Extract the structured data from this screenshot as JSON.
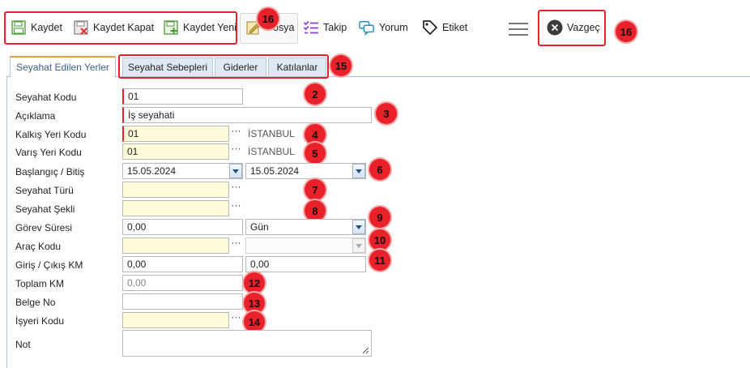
{
  "toolbar": {
    "save": "Kaydet",
    "save_close": "Kaydet Kapat",
    "save_new": "Kaydet Yeni",
    "file": "Dosya",
    "follow": "Takip",
    "comment": "Yorum",
    "tag": "Etiket",
    "cancel": "Vazgeç"
  },
  "tabs": {
    "main": "Seyahat Edilen Yerler",
    "reasons": "Seyahat Sebepleri",
    "expenses": "Giderler",
    "participants": "Katılanlar"
  },
  "badges": {
    "b2": "2",
    "b3": "3",
    "b4": "4",
    "b5": "5",
    "b6": "6",
    "b7": "7",
    "b8": "8",
    "b9": "9",
    "b10": "10",
    "b11": "11",
    "b12": "12",
    "b13": "13",
    "b14": "14",
    "b15": "15",
    "b16a": "16",
    "b16b": "16"
  },
  "form": {
    "travel_code": {
      "label": "Seyahat Kodu",
      "value": "01"
    },
    "description": {
      "label": "Açıklama",
      "value": "İş seyahati"
    },
    "departure": {
      "label": "Kalkış Yeri Kodu",
      "value": "01",
      "name": "İSTANBUL"
    },
    "arrival": {
      "label": "Varış Yeri Kodu",
      "value": "01",
      "name": "İSTANBUL"
    },
    "dates": {
      "label": "Başlangıç / Bitiş",
      "start": "15.05.2024",
      "end": "15.05.2024"
    },
    "travel_type": {
      "label": "Seyahat Türü",
      "value": ""
    },
    "travel_mode": {
      "label": "Seyahat Şekli",
      "value": ""
    },
    "duty_duration": {
      "label": "Görev Süresi",
      "value": "0,00",
      "unit": "Gün"
    },
    "vehicle_code": {
      "label": "Araç Kodu",
      "value": ""
    },
    "km": {
      "label": "Giriş / Çıkış KM",
      "in": "0,00",
      "out": "0,00"
    },
    "total_km": {
      "label": "Toplam KM",
      "value": "0,00"
    },
    "doc_no": {
      "label": "Belge No",
      "value": ""
    },
    "workplace_code": {
      "label": "İşyeri Kodu",
      "value": ""
    },
    "note": {
      "label": "Not",
      "value": ""
    }
  },
  "colors": {
    "annotation": "#e8212a",
    "required": "#e8212a",
    "lookup_bg": "#fffbd9",
    "tab_accent": "#e9a23b"
  }
}
